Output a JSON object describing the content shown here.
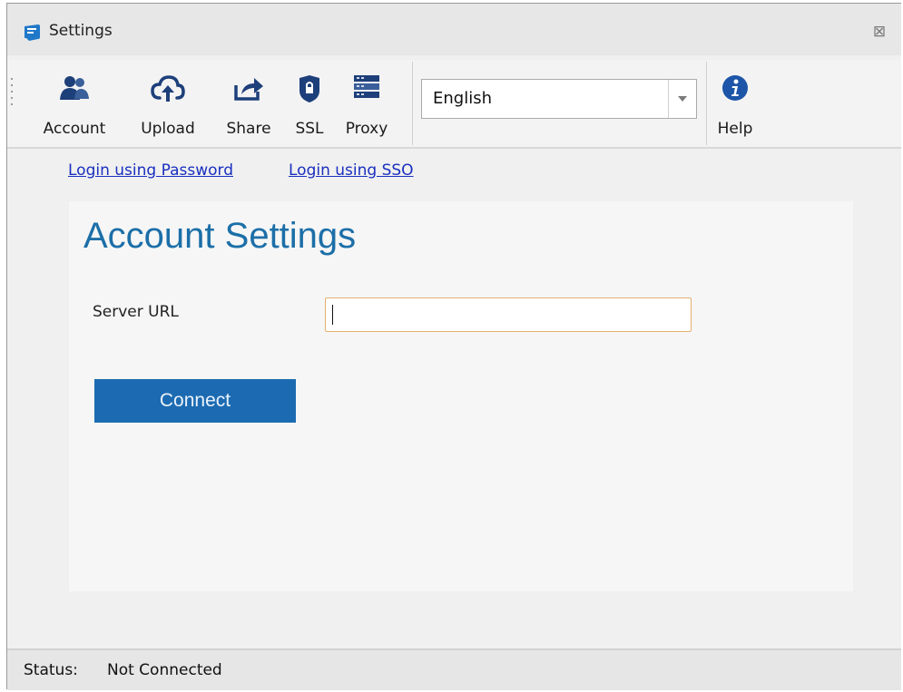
{
  "window": {
    "title": "Settings",
    "close_label": "⊠"
  },
  "toolbar": {
    "buttons": [
      {
        "label": "Account",
        "icon": "account-users-icon"
      },
      {
        "label": "Upload",
        "icon": "cloud-upload-icon"
      },
      {
        "label": "Share",
        "icon": "share-arrow-icon"
      },
      {
        "label": "SSL",
        "icon": "shield-lock-icon"
      },
      {
        "label": "Proxy",
        "icon": "server-rack-icon"
      },
      {
        "label": "Help",
        "icon": "info-icon"
      }
    ],
    "language": {
      "selected": "English"
    }
  },
  "login_links": {
    "password": "Login using Password",
    "sso": "Login using SSO"
  },
  "account_panel": {
    "title": "Account Settings",
    "server_url_label": "Server URL",
    "server_url_value": "",
    "connect_label": "Connect"
  },
  "status": {
    "label": "Status:",
    "value": "Not Connected"
  },
  "colors": {
    "accent": "#1c6fa8",
    "button": "#1c6bb2",
    "link": "#1a2fbf",
    "input_focus_border": "#e5b070"
  }
}
